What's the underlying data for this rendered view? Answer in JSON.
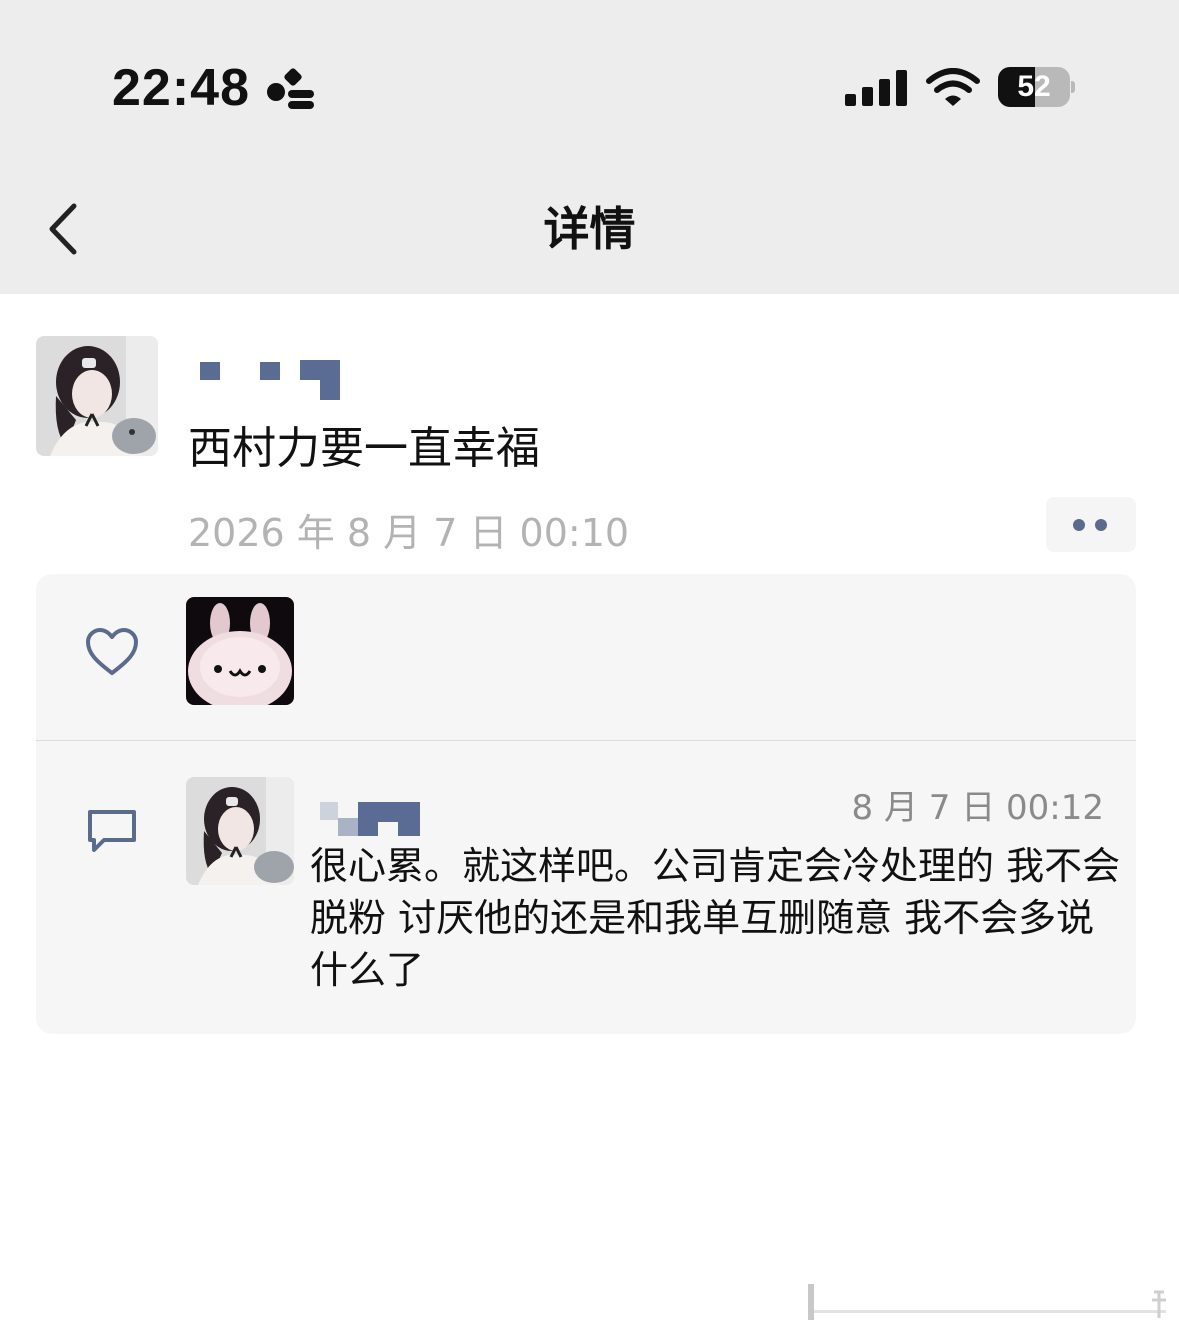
{
  "status_bar": {
    "time": "22:48",
    "battery_level": "52",
    "battery_fraction": 0.52
  },
  "nav": {
    "title": "详情"
  },
  "post": {
    "text": "西村力要一直幸福",
    "time": "2026 年 8 月 7 日 00:10"
  },
  "comment": {
    "time": "8 月 7 日 00:12",
    "text": "很心累。就这样吧。公司肯定会冷处理的 我不会脱粉 讨厌他的还是和我单互删随意 我不会多说什么了"
  },
  "colors": {
    "header_bg": "#ededed",
    "accent": "#5a6b8c",
    "panel_bg": "#f6f6f6"
  },
  "icons": [
    "back-arrow-icon",
    "heart-icon",
    "comment-icon",
    "more-dots-icon",
    "signal-icon",
    "wifi-icon",
    "battery-icon",
    "focus-mode-icon"
  ]
}
